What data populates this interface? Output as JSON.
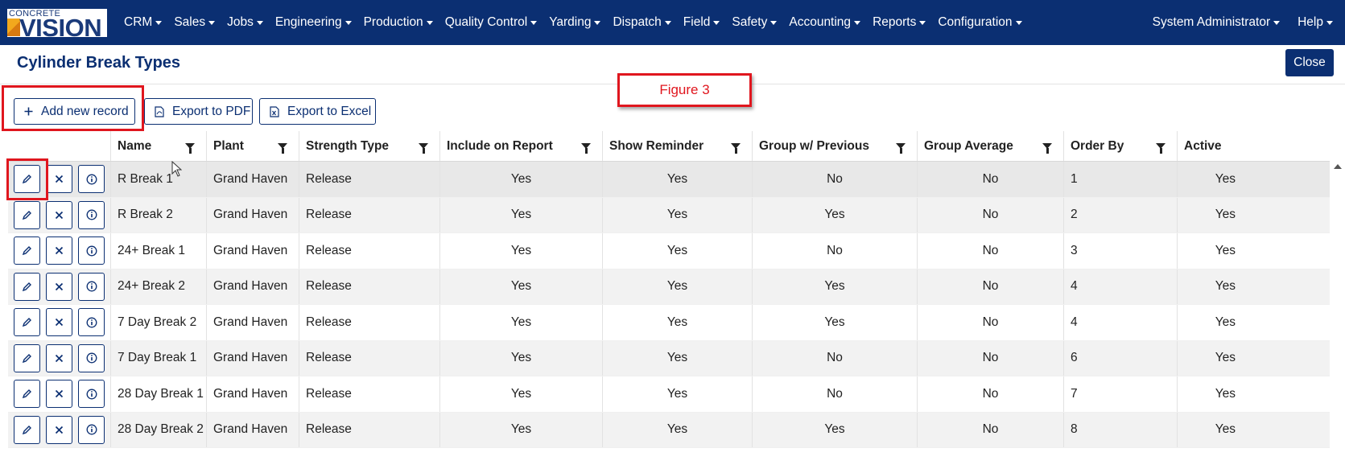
{
  "logo": {
    "top_text": "CONCRETE",
    "main_text": "VISION"
  },
  "nav": {
    "items": [
      "CRM",
      "Sales",
      "Jobs",
      "Engineering",
      "Production",
      "Quality Control",
      "Yarding",
      "Dispatch",
      "Field",
      "Safety",
      "Accounting",
      "Reports",
      "Configuration"
    ],
    "user": "System Administrator",
    "help": "Help"
  },
  "page": {
    "title": "Cylinder Break Types",
    "close_label": "Close"
  },
  "toolbar": {
    "add_label": "Add new record",
    "export_pdf_label": "Export to PDF",
    "export_excel_label": "Export to Excel"
  },
  "annotation": {
    "figure_label": "Figure 3"
  },
  "grid": {
    "columns": [
      "Name",
      "Plant",
      "Strength Type",
      "Include on Report",
      "Show Reminder",
      "Group w/ Previous",
      "Group Average",
      "Order By",
      "Active"
    ],
    "rows": [
      [
        "R Break 1",
        "Grand Haven",
        "Release",
        "Yes",
        "Yes",
        "No",
        "No",
        "1",
        "Yes"
      ],
      [
        "R Break 2",
        "Grand Haven",
        "Release",
        "Yes",
        "Yes",
        "Yes",
        "No",
        "2",
        "Yes"
      ],
      [
        "24+ Break 1",
        "Grand Haven",
        "Release",
        "Yes",
        "Yes",
        "No",
        "No",
        "3",
        "Yes"
      ],
      [
        "24+ Break 2",
        "Grand Haven",
        "Release",
        "Yes",
        "Yes",
        "Yes",
        "No",
        "4",
        "Yes"
      ],
      [
        "7 Day Break 2",
        "Grand Haven",
        "Release",
        "Yes",
        "Yes",
        "Yes",
        "No",
        "4",
        "Yes"
      ],
      [
        "7 Day Break 1",
        "Grand Haven",
        "Release",
        "Yes",
        "Yes",
        "No",
        "No",
        "6",
        "Yes"
      ],
      [
        "28 Day Break 1",
        "Grand Haven",
        "Release",
        "Yes",
        "Yes",
        "No",
        "No",
        "7",
        "Yes"
      ],
      [
        "28 Day Break 2",
        "Grand Haven",
        "Release",
        "Yes",
        "Yes",
        "Yes",
        "No",
        "8",
        "Yes"
      ]
    ]
  },
  "colors": {
    "brand": "#0b2f72",
    "annotation": "#e0161e"
  }
}
